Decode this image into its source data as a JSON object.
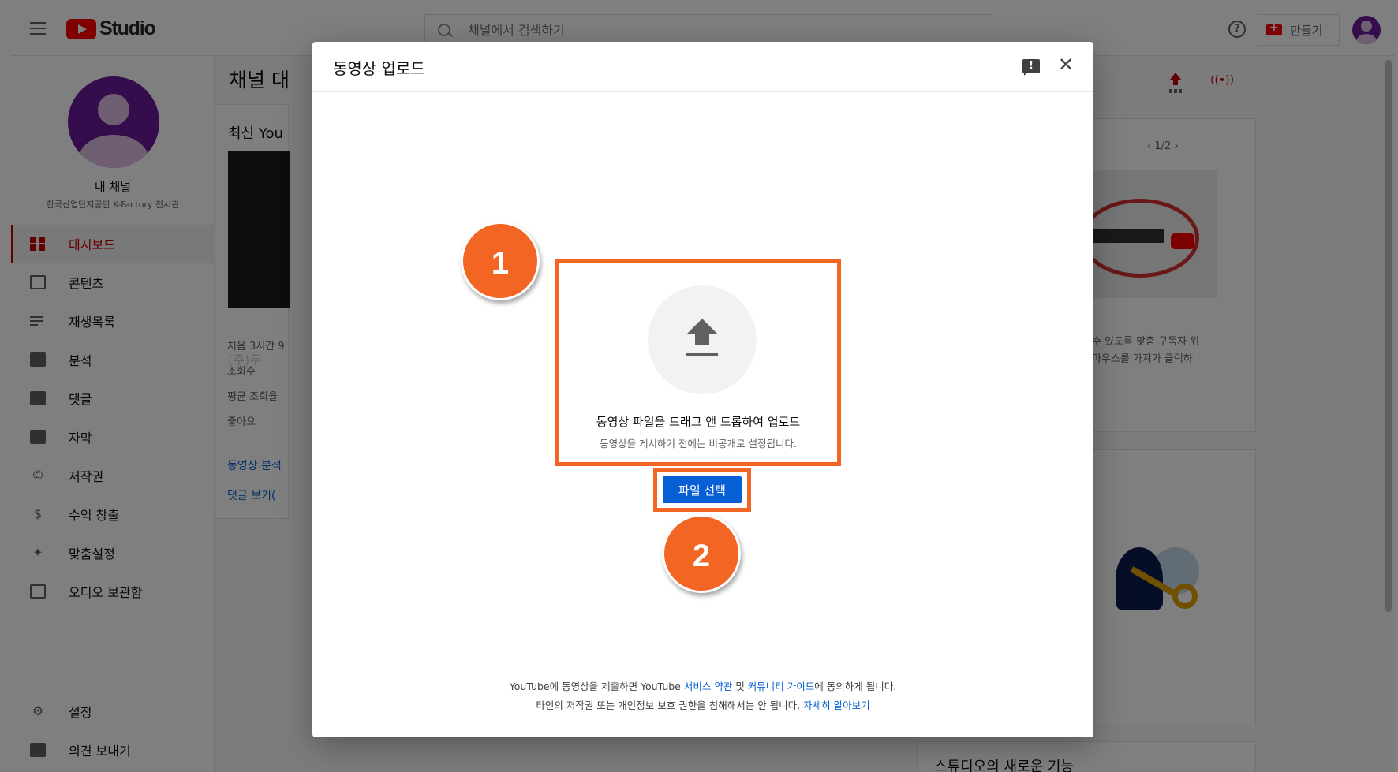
{
  "header": {
    "logo_text": "Studio",
    "search_placeholder": "채널에서 검색하기",
    "create_label": "만들기"
  },
  "sidebar": {
    "channel_name": "내 채널",
    "channel_sub": "한국산업단지공단 K-Factory 전시관",
    "items": [
      {
        "label": "대시보드",
        "icon": "dashboard-icon",
        "active": true
      },
      {
        "label": "콘텐츠",
        "icon": "content-icon"
      },
      {
        "label": "재생목록",
        "icon": "playlist-icon"
      },
      {
        "label": "분석",
        "icon": "analytics-icon"
      },
      {
        "label": "댓글",
        "icon": "comments-icon"
      },
      {
        "label": "자막",
        "icon": "subtitles-icon"
      },
      {
        "label": "저작권",
        "icon": "copyright-icon"
      },
      {
        "label": "수익 창출",
        "icon": "monetization-icon"
      },
      {
        "label": "맞춤설정",
        "icon": "customization-icon"
      },
      {
        "label": "오디오 보관함",
        "icon": "audio-library-icon"
      }
    ],
    "settings_label": "설정",
    "feedback_label": "의견 보내기"
  },
  "background": {
    "page_title": "채널 대",
    "latest_title": "최신 You",
    "thumb_label": "(주)두",
    "first_hours": "처음 3시간 9",
    "views": "조회수",
    "avg_view": "평균 조회율",
    "likes": "좋아요",
    "video_analytics_link": "동영상 분석",
    "comments_link": "댓글 보기(",
    "pager": "1/2",
    "right_text_1": "수 있도록 맞춤 구독자 위",
    "right_text_2": "마우스를 가져가 클릭하",
    "new_features": "스튜디오의 새로운 기능"
  },
  "dialog": {
    "title": "동영상 업로드",
    "drop_main": "동영상 파일을 드래그 앤 드롭하여 업로드",
    "drop_sub": "동영상을 게시하기 전에는 비공개로 설정됩니다.",
    "select_button": "파일 선택",
    "legal_line1_pre": "YouTube에 동영상을 제출하면 YouTube ",
    "legal_terms": "서비스 약관",
    "legal_and": " 및 ",
    "legal_guides": "커뮤니티 가이드",
    "legal_line1_post": "에 동의하게 됩니다.",
    "legal_line2_pre": "타인의 저작권 또는 개인정보 보호 권한을 침해해서는 안 됩니다. ",
    "legal_learn_more": "자세히 알아보기"
  },
  "annotations": {
    "step1": "1",
    "step2": "2"
  },
  "colors": {
    "accent_orange": "#f26522",
    "button_blue": "#065fd4",
    "brand_red": "#ff0000"
  }
}
